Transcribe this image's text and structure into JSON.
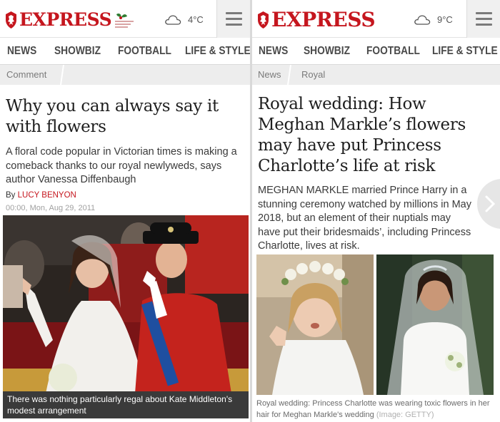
{
  "left": {
    "brand": "EXPRESS",
    "weather": "4°C",
    "nav": [
      "NEWS",
      "SHOWBIZ",
      "FOOTBALL",
      "LIFE & STYLE"
    ],
    "breadcrumb": [
      "Comment"
    ],
    "headline": "Why you can always say it with flowers",
    "standfirst": "A floral code popular in Victorian times is making a comeback thanks to our royal newlyweds, says author Vanessa Diffenbaugh",
    "byline_prefix": "By ",
    "author": "LUCY BENYON",
    "date": "00:00, Mon, Aug 29, 2011",
    "caption": "There was nothing particularly regal about Kate Middleton's modest arrangement"
  },
  "right": {
    "brand": "EXPRESS",
    "weather": "9°C",
    "nav": [
      "NEWS",
      "SHOWBIZ",
      "FOOTBALL",
      "LIFE & STYLE"
    ],
    "breadcrumb": [
      "News",
      "Royal"
    ],
    "headline": "Royal wedding: How Meghan Markle’s flowers may have put Princess Charlotte’s life at risk",
    "standfirst": "MEGHAN MARKLE married Prince Harry in a stunning ceremony watched by millions in May 2018, but an element of their nuptials may have put their bridesmaids’, including Princess Charlotte, lives at risk.",
    "caption": "Royal wedding: Princess Charlotte was wearing toxic flowers in her hair for Meghan Markle's wedding",
    "credit": "(Image: GETTY)"
  },
  "icons": {
    "logo": "lion-crest-icon",
    "weather": "cloud-icon",
    "menu": "hamburger-menu-icon",
    "next": "chevron-right-icon"
  },
  "colors": {
    "brand_red": "#c5161e",
    "nav_text": "#4a4a4a",
    "breadcrumb_bg": "#ededed",
    "caption_bg": "#3a3a3a"
  }
}
